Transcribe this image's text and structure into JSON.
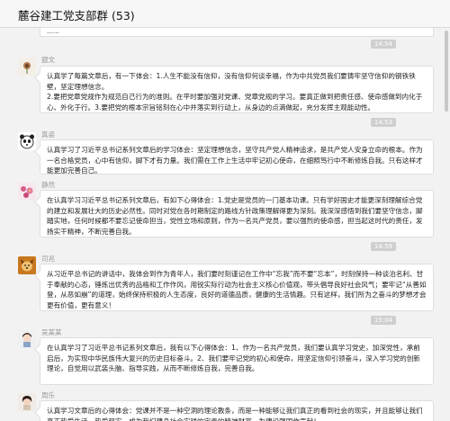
{
  "header": {
    "title": "麓谷建工党支部群",
    "count": "(53)"
  },
  "top_fragment": "……",
  "messages": [
    {
      "timestamp": "14:54",
      "sender": "题文",
      "avatar": "flower-avatar-icon",
      "lines": [
        "认真学了每篇文章后，有一下体会：1.人生不能没有信仰，没有信仰何谈幸福，作为中共党员我们要铸牢坚守信仰的钢铁铁壁，坚定理想信念。",
        "2.要把党章党规作为规范自己行为的准则。在平时要加强对党课、党章党规的学习。要真正做到把责任感、使命感做到内化于心、外化于行。3.要把党的根本宗旨铭刻在心中并落实到行动上，从身边的点滴做起，充分发挥主观能动性。"
      ]
    },
    {
      "timestamp": "14:53",
      "sender": "真姿",
      "avatar": "panda-avatar-icon",
      "lines": [
        "认真学习了习近平总书记系列文章后的学习体会：坚定理想信念，坚守共产党人精神追求，是共产党人安身立命的根本。作为一名合格党员，心中有信仰，脚下才有力量。我们需在工作上生活中牢记初心使命，在细照笃行中不断修炼自我。只有这样才能更加完善自己。"
      ]
    },
    {
      "timestamp": "",
      "sender": "静然",
      "avatar": "flowers-avatar-icon",
      "lines": [
        "在认真学习习近平总书记系列文章后，有如下心得体会：1.党史是党员的一门基本功课。只有学好国史才能更深刻理解综合党的建立和发展壮大的历史必然性。同时对党在各时期制定的路线方针政策理解得更为深刻。我深深感悟到我们要坚守信念，脚踏实地，任何时候都不要忘记使命担当，党性立场和原则，作为一名共产党员，要以强烈的使命感，担当起这时代的责任，发扬实干精神，不断完善自我。"
      ]
    },
    {
      "timestamp": "14:59",
      "sender": "司兆",
      "avatar": "dog-avatar-icon",
      "lines": [
        "从习近平总书记的讲话中，我体会到作为青年人，我们要时刻谨记在工作中“忘我”而不要“忘本”，时刻保持一种谈泊名利、甘于奉献的心态，锤炼出优秀的品格和工作作风，用锐实际行动为社会主义核心价值观，带头倡导良好社会风气；要牢记“从善如登，从恶如崩”的道理，始终保持积极的人生态度，良好的道德品质，健康的生活情趣。只有这样，我们所为之奋斗的梦想才会更有价值，更有意义！"
      ]
    },
    {
      "timestamp": "15:04",
      "sender": "吴某某",
      "avatar": "girl-avatar-icon",
      "lines": [
        "在认真学习了习近平总书记系列文章后，我有以下心得体会：1、作为一名共产党员，我们要认真学习党史，加深党性，承前启后，为实现中华民族伟大复兴的历史目标奋斗。2、我们要牢记党的初心和使命，用坚定信仰引领奋斗，深入学习党的创新理论，自觉用以武装头脑、指导实践，从而不断修炼自我，完善自我。"
      ]
    },
    {
      "timestamp": "",
      "sender": "周乐",
      "avatar": "woman-avatar-icon",
      "lines": [
        "认真学习文章后的心得体会：党课并不是一种空洞的理论教条，而是一种能够让我们真正的看到社会的现实，并且能够让我们真正热爱生活，热爱现实。成为我们建身社会实践的宝贵的精神财富，为建设强国作贡献！"
      ]
    }
  ]
}
